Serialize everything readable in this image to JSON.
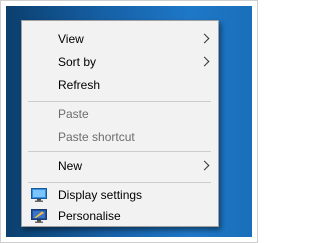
{
  "context_menu": {
    "items": [
      {
        "label": "View",
        "has_submenu": true,
        "enabled": true
      },
      {
        "label": "Sort by",
        "has_submenu": true,
        "enabled": true
      },
      {
        "label": "Refresh",
        "has_submenu": false,
        "enabled": true
      },
      {
        "label": "Paste",
        "has_submenu": false,
        "enabled": false
      },
      {
        "label": "Paste shortcut",
        "has_submenu": false,
        "enabled": false
      },
      {
        "label": "New",
        "has_submenu": true,
        "enabled": true
      },
      {
        "label": "Display settings",
        "has_submenu": false,
        "enabled": true,
        "icon": "display-settings-icon"
      },
      {
        "label": "Personalise",
        "has_submenu": false,
        "enabled": true,
        "icon": "personalise-icon"
      }
    ]
  },
  "colors": {
    "menu_background": "#f2f2f2",
    "desktop_background": "#1660a6",
    "disabled_text": "#6d6d6d"
  }
}
